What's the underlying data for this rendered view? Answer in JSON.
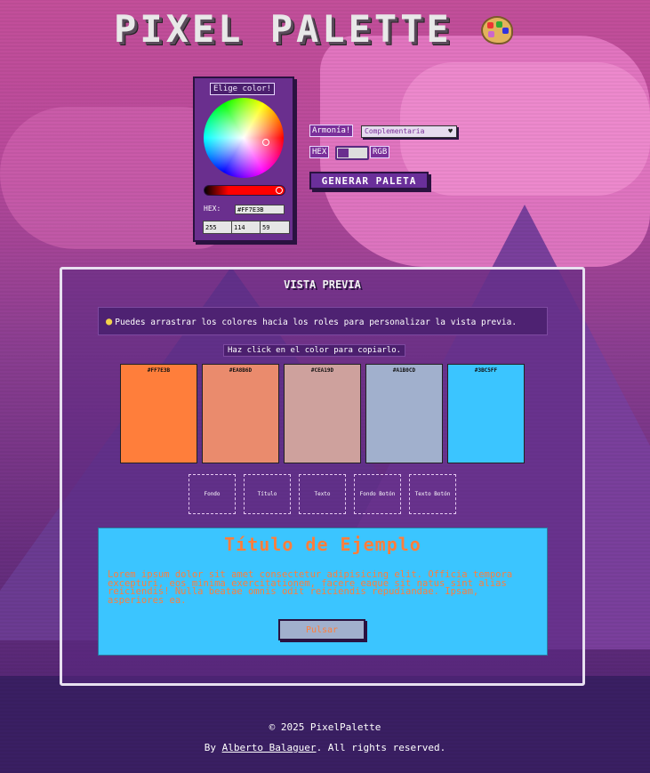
{
  "header": {
    "title": "PIXEL PALETTE",
    "icon": "artist-palette-icon"
  },
  "picker": {
    "label": "Elige color!",
    "hex_label": "HEX:",
    "hex_value": "#FF7E3B",
    "r": "255",
    "g": "114",
    "b": "59"
  },
  "controls": {
    "harmony_label": "Armonía!",
    "harmony_value": "Complementaria",
    "hex_toggle": "HEX",
    "rgb_toggle": "RGB",
    "generate_button": "GENERAR PALETA"
  },
  "preview": {
    "title": "VISTA PREVIA",
    "tip": "Puedes arrastrar los colores hacia los roles para personalizar la vista previa.",
    "copy_hint": "Haz click en el color para copiarlo.",
    "swatches": [
      {
        "hex": "#FF7E3B",
        "color": "#ff7e3b"
      },
      {
        "hex": "#EA8B6D",
        "color": "#ea8b6d"
      },
      {
        "hex": "#CEA19D",
        "color": "#cea19d"
      },
      {
        "hex": "#A1B0CD",
        "color": "#a1b0cd"
      },
      {
        "hex": "#3BC5FF",
        "color": "#3bc5ff"
      }
    ],
    "roles": [
      "Fondo",
      "Título",
      "Texto",
      "Fondo Botón",
      "Texto Botón"
    ],
    "sample": {
      "heading": "Título de Ejemplo",
      "body": "Lorem ipsum dolor sit amet consectetur adipisicing elit. Officia tempora excepturi, eos minima exercitationem, facere eaque sit natus sint alias reiciendis! Nulla beatae omnis odit reiciendis repudiandae. Ipsam, asperiores ea.",
      "button": "Pulsar"
    }
  },
  "footer": {
    "copyright": "© 2025 PixelPalette",
    "by_prefix": "By ",
    "author": "Alberto Balaguer",
    "rights": ". All rights reserved."
  }
}
